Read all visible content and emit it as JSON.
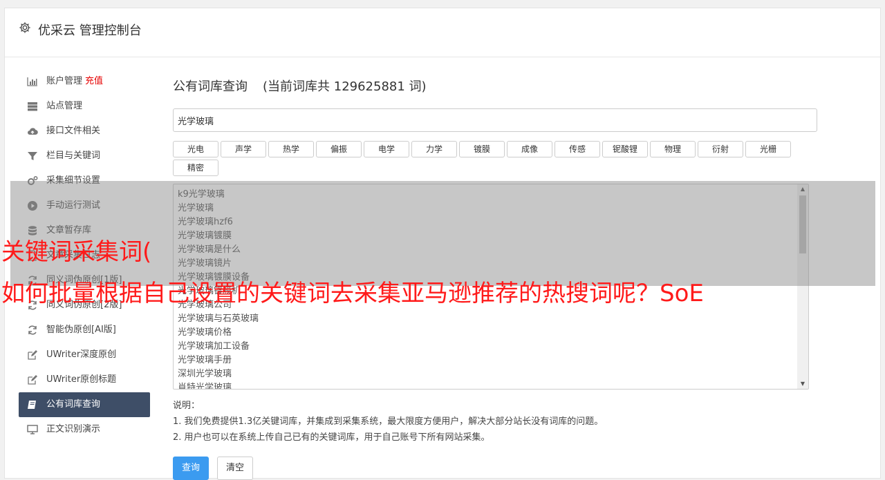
{
  "header": {
    "icon": "gear-icon",
    "title": "优采云 管理控制台"
  },
  "sidebar": {
    "recharge": "充值",
    "items": [
      {
        "icon": "bar-chart-icon",
        "label": "账户管理"
      },
      {
        "icon": "server-icon",
        "label": "站点管理"
      },
      {
        "icon": "cloud-upload-icon",
        "label": "接口文件相关"
      },
      {
        "icon": "filter-icon",
        "label": "栏目与关键词"
      },
      {
        "icon": "cogs-icon",
        "label": "采集细节设置"
      },
      {
        "icon": "play-circle-icon",
        "label": "手动运行测试"
      },
      {
        "icon": "database-icon",
        "label": "文章暂存库"
      },
      {
        "icon": "file-icon",
        "label": "文章采集日志"
      },
      {
        "icon": "refresh-icon",
        "label": "同义词伪原创[1版]"
      },
      {
        "icon": "refresh-icon",
        "label": "同义词伪原创[2版]"
      },
      {
        "icon": "refresh-icon",
        "label": "智能伪原创[AI版]"
      },
      {
        "icon": "edit-icon",
        "label": "UWriter深度原创"
      },
      {
        "icon": "edit-icon",
        "label": "UWriter原创标题"
      },
      {
        "icon": "book-icon",
        "label": "公有词库查询"
      },
      {
        "icon": "monitor-icon",
        "label": "正文识别演示"
      }
    ]
  },
  "main": {
    "title": "公有词库查询",
    "count_text": "(当前词库共 129625881 词)",
    "query_value": "光学玻璃",
    "tags": [
      "光电",
      "声学",
      "热学",
      "偏振",
      "电学",
      "力学",
      "镀膜",
      "成像",
      "传感",
      "铌酸锂",
      "物理",
      "衍射",
      "光栅",
      "精密"
    ],
    "results": [
      "k9光学玻璃",
      "光学玻璃",
      "光学玻璃hzf6",
      "光学玻璃镀膜",
      "光学玻璃是什么",
      "光学玻璃镜片",
      "光学玻璃镀膜设备",
      "光学玻璃镀膜机",
      "光学玻璃公司",
      "光学玻璃与石英玻璃",
      "光学玻璃价格",
      "光学玻璃加工设备",
      "光学玻璃手册",
      "深圳光学玻璃",
      "肖特光学玻璃"
    ],
    "notes_title": "说明：",
    "notes": [
      "1. 我们免费提供1.3亿关键词库，并集成到采集系统，最大限度方便用户，解决大部分站长没有词库的问题。",
      "2. 用户也可以在系统上传自己已有的关键词库，用于自己账号下所有网站采集。"
    ],
    "query_button": "查询",
    "clear_button": "清空"
  },
  "caption": {
    "line1": "关键词采集词(",
    "line2": "如何批量根据自己设置的关键词去采集亚马逊推荐的热搜词呢？SoE",
    "color": "#ff1a1a"
  }
}
